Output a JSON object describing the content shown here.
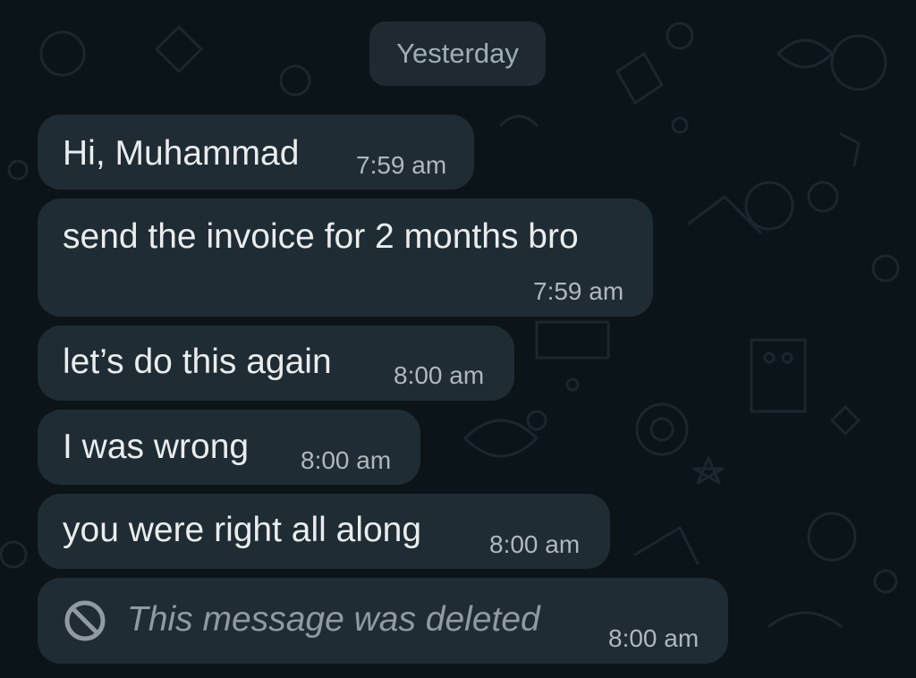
{
  "chat": {
    "date_divider": "Yesterday",
    "messages": [
      {
        "text": "Hi, Muhammad",
        "time": "7:59 am"
      },
      {
        "text": "send the invoice for 2 months bro",
        "time": "7:59 am"
      },
      {
        "text": "let’s do this again",
        "time": "8:00 am"
      },
      {
        "text": "I was wrong",
        "time": "8:00 am"
      },
      {
        "text": "you were right all along",
        "time": "8:00 am"
      },
      {
        "text": "This message was deleted",
        "time": "8:00 am",
        "deleted": true,
        "icon": "ban-icon"
      }
    ]
  },
  "colors": {
    "background": "#0b1419",
    "bubble": "#1f2c33",
    "date_chip": "#1e2a30",
    "text": "#e9edef",
    "timestamp": "#aeb8bd",
    "deleted_text": "#8f9ba1"
  }
}
